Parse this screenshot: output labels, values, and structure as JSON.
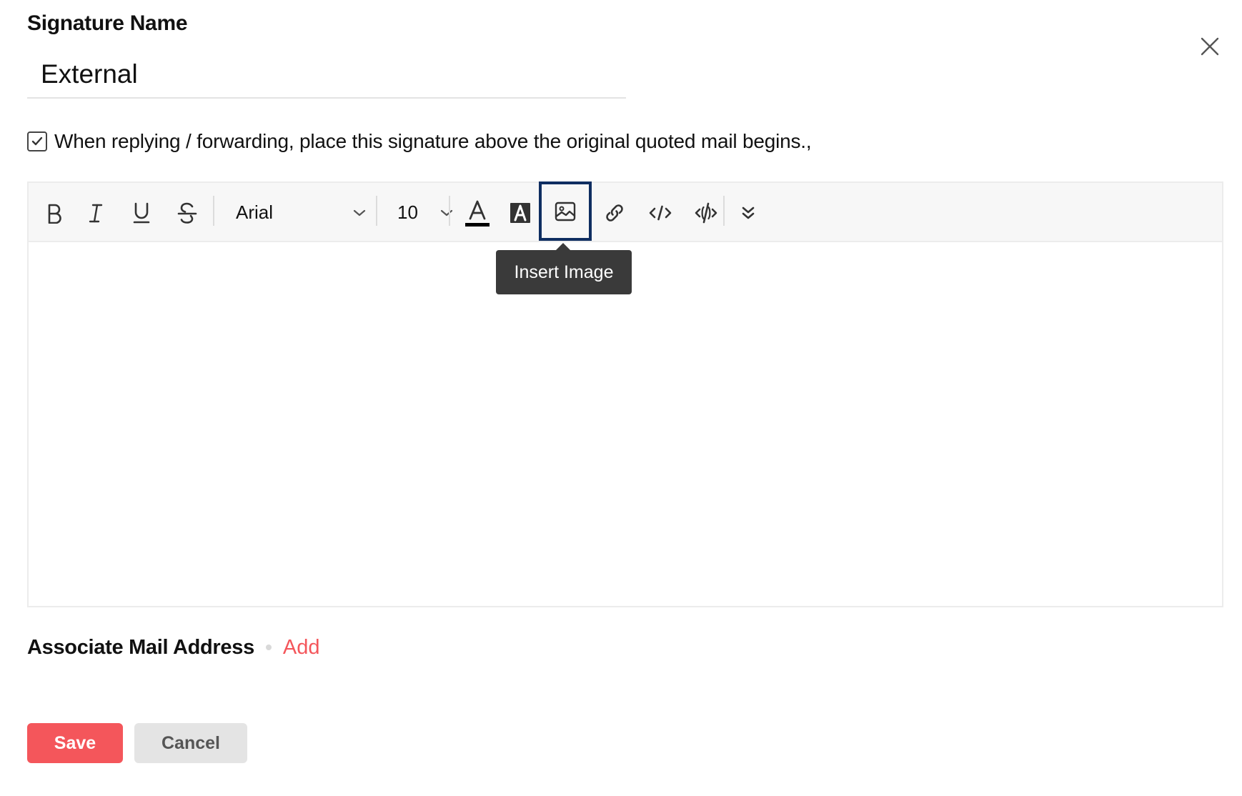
{
  "signature": {
    "label": "Signature Name",
    "name_value": "External"
  },
  "placement": {
    "checked": true,
    "text": "When replying / forwarding, place this signature above the original quoted mail begins.,"
  },
  "toolbar": {
    "buttons": [
      {
        "icon": "bold-icon",
        "glyph": "B"
      },
      {
        "icon": "italic-icon",
        "glyph": "I"
      },
      {
        "icon": "underline-icon",
        "glyph": "U"
      },
      {
        "icon": "strikethrough-icon",
        "glyph": "S"
      },
      {
        "icon": "text-color-icon"
      },
      {
        "icon": "highlight-color-icon"
      },
      {
        "icon": "insert-image-icon",
        "highlighted": true
      },
      {
        "icon": "link-icon"
      },
      {
        "icon": "code-icon"
      },
      {
        "icon": "html-source-icon"
      },
      {
        "icon": "more-options-icon"
      }
    ],
    "font": "Arial",
    "size": "10",
    "text_color": "#000000",
    "tooltip": "Insert Image"
  },
  "associate": {
    "label": "Associate Mail Address",
    "add_label": "Add"
  },
  "actions": {
    "save_label": "Save",
    "cancel_label": "Cancel"
  },
  "colors": {
    "accent": "#f4565b",
    "focus_outline": "#0f2e61",
    "tooltip_bg": "#3a3a3a"
  }
}
